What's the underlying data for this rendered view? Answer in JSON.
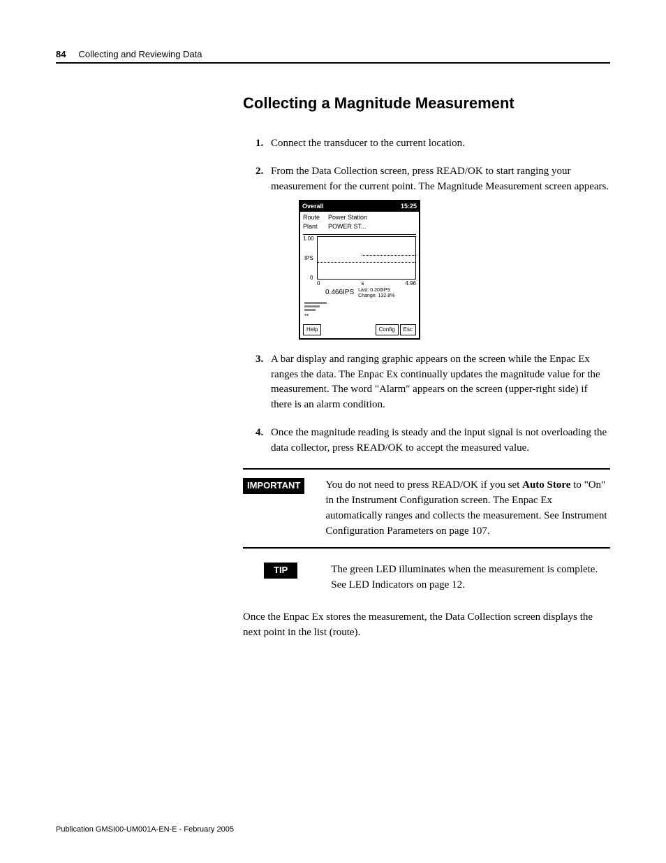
{
  "header": {
    "page_number": "84",
    "section": "Collecting and Reviewing Data"
  },
  "title": "Collecting a Magnitude Measurement",
  "steps": {
    "s1": {
      "num": "1.",
      "text": "Connect the transducer to the current location."
    },
    "s2": {
      "num": "2.",
      "text": "From the Data Collection screen, press READ/OK to start ranging your measurement for the current point. The Magnitude Measurement screen appears."
    },
    "s3": {
      "num": "3.",
      "text": "A bar display and ranging graphic appears on the screen while the Enpac Ex ranges the data. The Enpac Ex continually updates the magnitude value for the measurement. The word \"Alarm\" appears on the screen (upper-right side) if there is an alarm condition."
    },
    "s4": {
      "num": "4.",
      "text": "Once the magnitude reading is steady and the input signal is not overloading the data collector, press READ/OK to accept the measured value."
    }
  },
  "screenshot": {
    "title_left": "Overall",
    "title_right": "15:25",
    "route_label": "Route",
    "route_value": "Power Station",
    "plant_label": "Plant",
    "plant_value": "POWER ST...",
    "y_top": "1.00",
    "y_mid": "IPS",
    "y_bot": "0",
    "x_left": "0",
    "x_mid": "s",
    "x_right": "4.96",
    "readout_main": "0.466IPS",
    "readout_sub1": "Last: 0.200IPS",
    "readout_sub2": "Change: 132.8%",
    "stars": "**",
    "btn_help": "Help",
    "btn_config": "Config",
    "btn_esc": "Esc"
  },
  "important": {
    "label": "IMPORTANT",
    "text_before_bold": "You do not need to press READ/OK if you set ",
    "bold": "Auto Store",
    "text_after_bold": " to \"On\" in the Instrument Configuration screen. The Enpac Ex automatically ranges and collects the measurement. See Instrument Configuration Parameters on page 107."
  },
  "tip": {
    "label": "TIP",
    "text": "The green LED illuminates when the measurement is complete. See LED Indicators on page 12."
  },
  "after": "Once the Enpac Ex stores the measurement, the Data Collection screen displays the next point in the list (route).",
  "footer": "Publication GMSI00-UM001A-EN-E - February 2005"
}
